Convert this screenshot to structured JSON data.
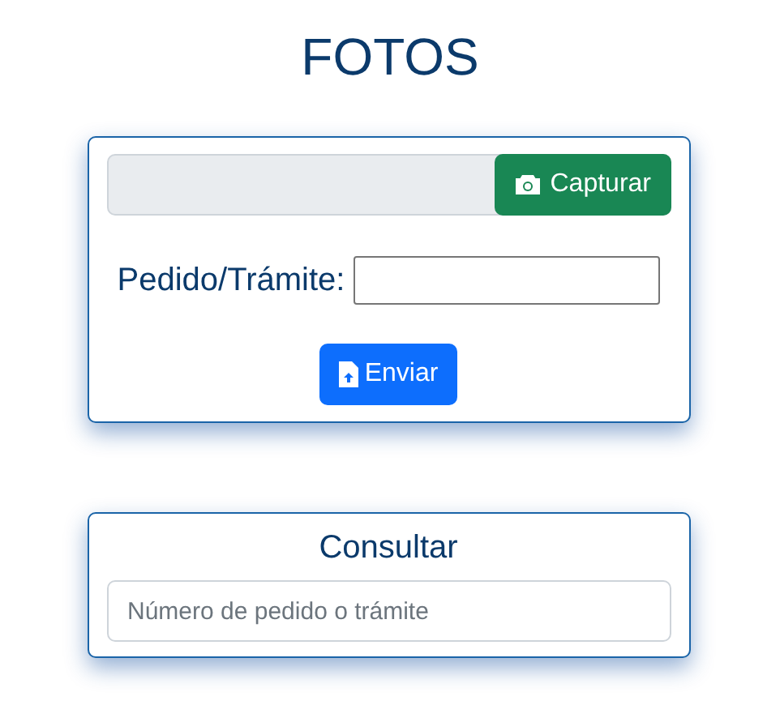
{
  "title": "FOTOS",
  "upload_card": {
    "capture_button": "Capturar",
    "order_label": "Pedido/Trámite:",
    "send_button": "Enviar"
  },
  "query_card": {
    "title": "Consultar",
    "search": {
      "placeholder": "Número de pedido o trámite"
    }
  }
}
